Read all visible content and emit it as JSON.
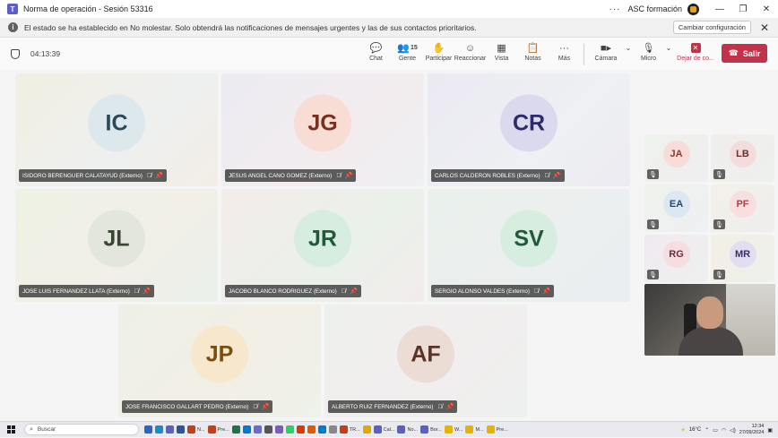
{
  "window": {
    "title": "Norma de operación - Sesión 53316",
    "more": "···",
    "org": "ASC formación",
    "controls": {
      "minimize": "—",
      "maximize": "❐",
      "close": "✕"
    }
  },
  "notification": {
    "message": "El estado se ha establecido en No molestar. Solo obtendrá las notificaciones de mensajes urgentes y las de sus contactos prioritarios.",
    "change_button": "Cambiar configuración",
    "close": "✕"
  },
  "toolbar": {
    "timer": "04:13:39",
    "items": [
      {
        "key": "chat",
        "label": "Chat",
        "icon": "💬"
      },
      {
        "key": "people",
        "label": "Gente",
        "icon": "👥",
        "badge": "15"
      },
      {
        "key": "raise",
        "label": "Participar",
        "icon": "✋"
      },
      {
        "key": "react",
        "label": "Reaccionar",
        "icon": "☺"
      },
      {
        "key": "view",
        "label": "Vista",
        "icon": "▦"
      },
      {
        "key": "notes",
        "label": "Notas",
        "icon": "📋"
      },
      {
        "key": "more",
        "label": "Más",
        "icon": "···"
      }
    ],
    "camera_label": "Cámara",
    "mic_label": "Micro",
    "leave_label": "Dejar de co...",
    "exit_label": "Salir"
  },
  "participants": [
    {
      "initials": "IC",
      "name": "ISIDORO BERENGUER CALATAYUD (Externo)",
      "bg": "#dde8ec",
      "fg": "#2b4a5a"
    },
    {
      "initials": "JG",
      "name": "JESUS ANGEL CANO GOMEZ (Externo)",
      "bg": "#f8ddd5",
      "fg": "#7a2f1f"
    },
    {
      "initials": "CR",
      "name": "CARLOS CALDERON ROBLES (Externo)",
      "bg": "#dad9ee",
      "fg": "#2f2a6a"
    },
    {
      "initials": "JL",
      "name": "JOSE LUIS FERNANDEZ LLATA (Externo)",
      "bg": "#e2e6dc",
      "fg": "#3a4532"
    },
    {
      "initials": "JR",
      "name": "JACOBO BLANCO RODRIGUEZ (Externo)",
      "bg": "#d6ede0",
      "fg": "#1f5a3a"
    },
    {
      "initials": "SV",
      "name": "SERGIO ALONSO VALDES (Externo)",
      "bg": "#d6eddf",
      "fg": "#1f5a3a"
    },
    {
      "initials": "JP",
      "name": "JOSE FRANCISCO GALLART PEDRO (Externo)",
      "bg": "#f7e7cc",
      "fg": "#7a4e10"
    },
    {
      "initials": "AF",
      "name": "ALBERTO RUIZ FERNANDEZ (Externo)",
      "bg": "#ecdcd6",
      "fg": "#5a3428"
    }
  ],
  "gallery": [
    {
      "initials": "JA",
      "bg": "#f8dcd9",
      "fg": "#8a3a32"
    },
    {
      "initials": "LB",
      "bg": "#f3dcdc",
      "fg": "#6e2f2f"
    },
    {
      "initials": "EA",
      "bg": "#dde7f2",
      "fg": "#27486a"
    },
    {
      "initials": "PF",
      "bg": "#f8dede",
      "fg": "#b0404a"
    },
    {
      "initials": "RG",
      "bg": "#f5dde0",
      "fg": "#6a3038"
    },
    {
      "initials": "MR",
      "bg": "#e2def0",
      "fg": "#3a2f6a"
    }
  ],
  "taskbar": {
    "search_placeholder": "Buscar",
    "apps": [
      {
        "label": "",
        "color": "#2b64c7"
      },
      {
        "label": "",
        "color": "#1a8cc8"
      },
      {
        "label": "",
        "color": "#5b5fc7"
      },
      {
        "label": "",
        "color": "#2b579a"
      },
      {
        "label": "N...",
        "color": "#c43e1c"
      },
      {
        "label": "Pre...",
        "color": "#c43e1c"
      },
      {
        "label": "",
        "color": "#217346"
      },
      {
        "label": "",
        "color": "#0078d4"
      },
      {
        "label": "",
        "color": "#6b69d6"
      },
      {
        "label": "",
        "color": "#555555"
      },
      {
        "label": "",
        "color": "#7a5cc7"
      },
      {
        "label": "",
        "color": "#25d366"
      },
      {
        "label": "",
        "color": "#d83b01"
      },
      {
        "label": "",
        "color": "#e05a00"
      },
      {
        "label": "",
        "color": "#0078d4"
      },
      {
        "label": "",
        "color": "#888888"
      },
      {
        "label": "TR...",
        "color": "#c43e1c"
      },
      {
        "label": "",
        "color": "#e0a800"
      },
      {
        "label": "Cal...",
        "color": "#5b5fc7"
      },
      {
        "label": "No...",
        "color": "#5b5fc7"
      },
      {
        "label": "Bor...",
        "color": "#5b5fc7"
      },
      {
        "label": "W...",
        "color": "#e8b200"
      },
      {
        "label": "M...",
        "color": "#e8b200"
      },
      {
        "label": "Pre...",
        "color": "#e8b200"
      }
    ],
    "weather": "16°C",
    "time": "12:34",
    "date": "27/09/2024"
  }
}
